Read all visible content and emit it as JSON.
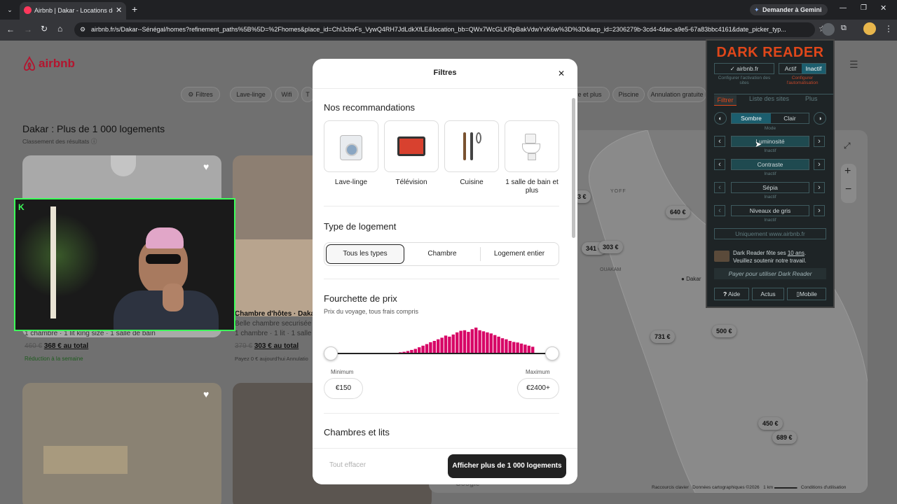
{
  "browser": {
    "tab_title": "Airbnb | Dakar - Locations de v...",
    "gemini_label": "Demander à Gemini",
    "url": "airbnb.fr/s/Dakar--Sénégal/homes?refinement_paths%5B%5D=%2Fhomes&place_id=ChIJcbvFs_VywQ4RH7JdLdkXfLE&location_bb=QWx7WcGLKRpBakVdwYxK6w%3D%3D&acp_id=2306279b-3cd4-4dac-a9e5-67a83bbc4161&date_picker_typ..."
  },
  "header": {
    "logo": "airbnb",
    "filter_pills": [
      "Filtres",
      "Lave-linge",
      "Wifi",
      "T",
      "re et plus",
      "Piscine",
      "Annulation gratuite"
    ]
  },
  "results": {
    "title": "Dakar : Plus de 1 000 logements",
    "ranking": "Classement des résultats",
    "card1": {
      "info": "1 chambre · 1 lit king size · 1 salle de bain",
      "old_price": "460 €",
      "price": "368 € au total",
      "badge": "Réduction à la semaine"
    },
    "card2": {
      "title": "Chambre d'hôtes · Daka",
      "subtitle": "Belle chambre securisée",
      "info": "1 chambre · 1 lit · 1 salle d",
      "old_price": "379 €",
      "price": "303 € au total",
      "note": "Payez 0 € aujourd'hui",
      "note2": "Annulatio"
    }
  },
  "map": {
    "prices": [
      "3 €",
      "640 €",
      "341 €",
      "303 €",
      "731 €",
      "500 €",
      "450 €",
      "689 €"
    ],
    "labels": [
      "YOFF",
      "OUAKAM",
      "Dakar"
    ],
    "footer": [
      "Raccourcis clavier",
      "Données cartographiques ©2026",
      "1 km",
      "Conditions d'utilisation"
    ],
    "google": "Google"
  },
  "modal": {
    "title": "Filtres",
    "reco_title": "Nos recommandations",
    "amenities": [
      "Lave-linge",
      "Télévision",
      "Cuisine",
      "1 salle de bain et plus"
    ],
    "type_title": "Type de logement",
    "types": [
      "Tous les types",
      "Chambre",
      "Logement entier"
    ],
    "price_title": "Fourchette de prix",
    "price_sub": "Prix du voyage, tous frais compris",
    "min_label": "Minimum",
    "max_label": "Maximum",
    "min_value": "€150",
    "max_value": "€2400+",
    "histogram": [
      0.02,
      0.03,
      0.03,
      0.04,
      0.05,
      0.07,
      0.09,
      0.12,
      0.16,
      0.2,
      0.26,
      0.32,
      0.38,
      0.45,
      0.5,
      0.56,
      0.62,
      0.7,
      0.66,
      0.74,
      0.82,
      0.88,
      0.9,
      0.84,
      0.94,
      1.0,
      0.9,
      0.86,
      0.82,
      0.78,
      0.72,
      0.66,
      0.6,
      0.56,
      0.5,
      0.46,
      0.44,
      0.4,
      0.36,
      0.32,
      0.28
    ],
    "beds_title": "Chambres et lits",
    "clear": "Tout effacer",
    "show": "Afficher plus de 1 000 logements"
  },
  "darkreader": {
    "title": "DARK READER",
    "site": "✓ airbnb.fr",
    "actif": "Actif",
    "inactif": "Inactif",
    "cfg_sites": "Configurer l'activation des sites",
    "cfg_auto": "Configurer l'automatisation",
    "tabs": [
      "Filtrer",
      "Liste des sites",
      "Plus"
    ],
    "sombre": "Sombre",
    "clair": "Clair",
    "mode": "Mode",
    "sliders": [
      {
        "label": "Luminosité",
        "sub": "Inactif"
      },
      {
        "label": "Contraste",
        "sub": "Inactif"
      },
      {
        "label": "Sépia",
        "sub": "Inactif"
      },
      {
        "label": "Niveaux de gris",
        "sub": "Inactif"
      }
    ],
    "only": "Uniquement www.airbnb.fr",
    "promo1": "Dark Reader fête ses",
    "promo_link": "10 ans",
    "promo2": "Veuillez soutenir notre travail.",
    "pay": "Payer pour utiliser Dark Reader",
    "help": "Aide",
    "news": "Actus",
    "mobile": "Mobile"
  }
}
